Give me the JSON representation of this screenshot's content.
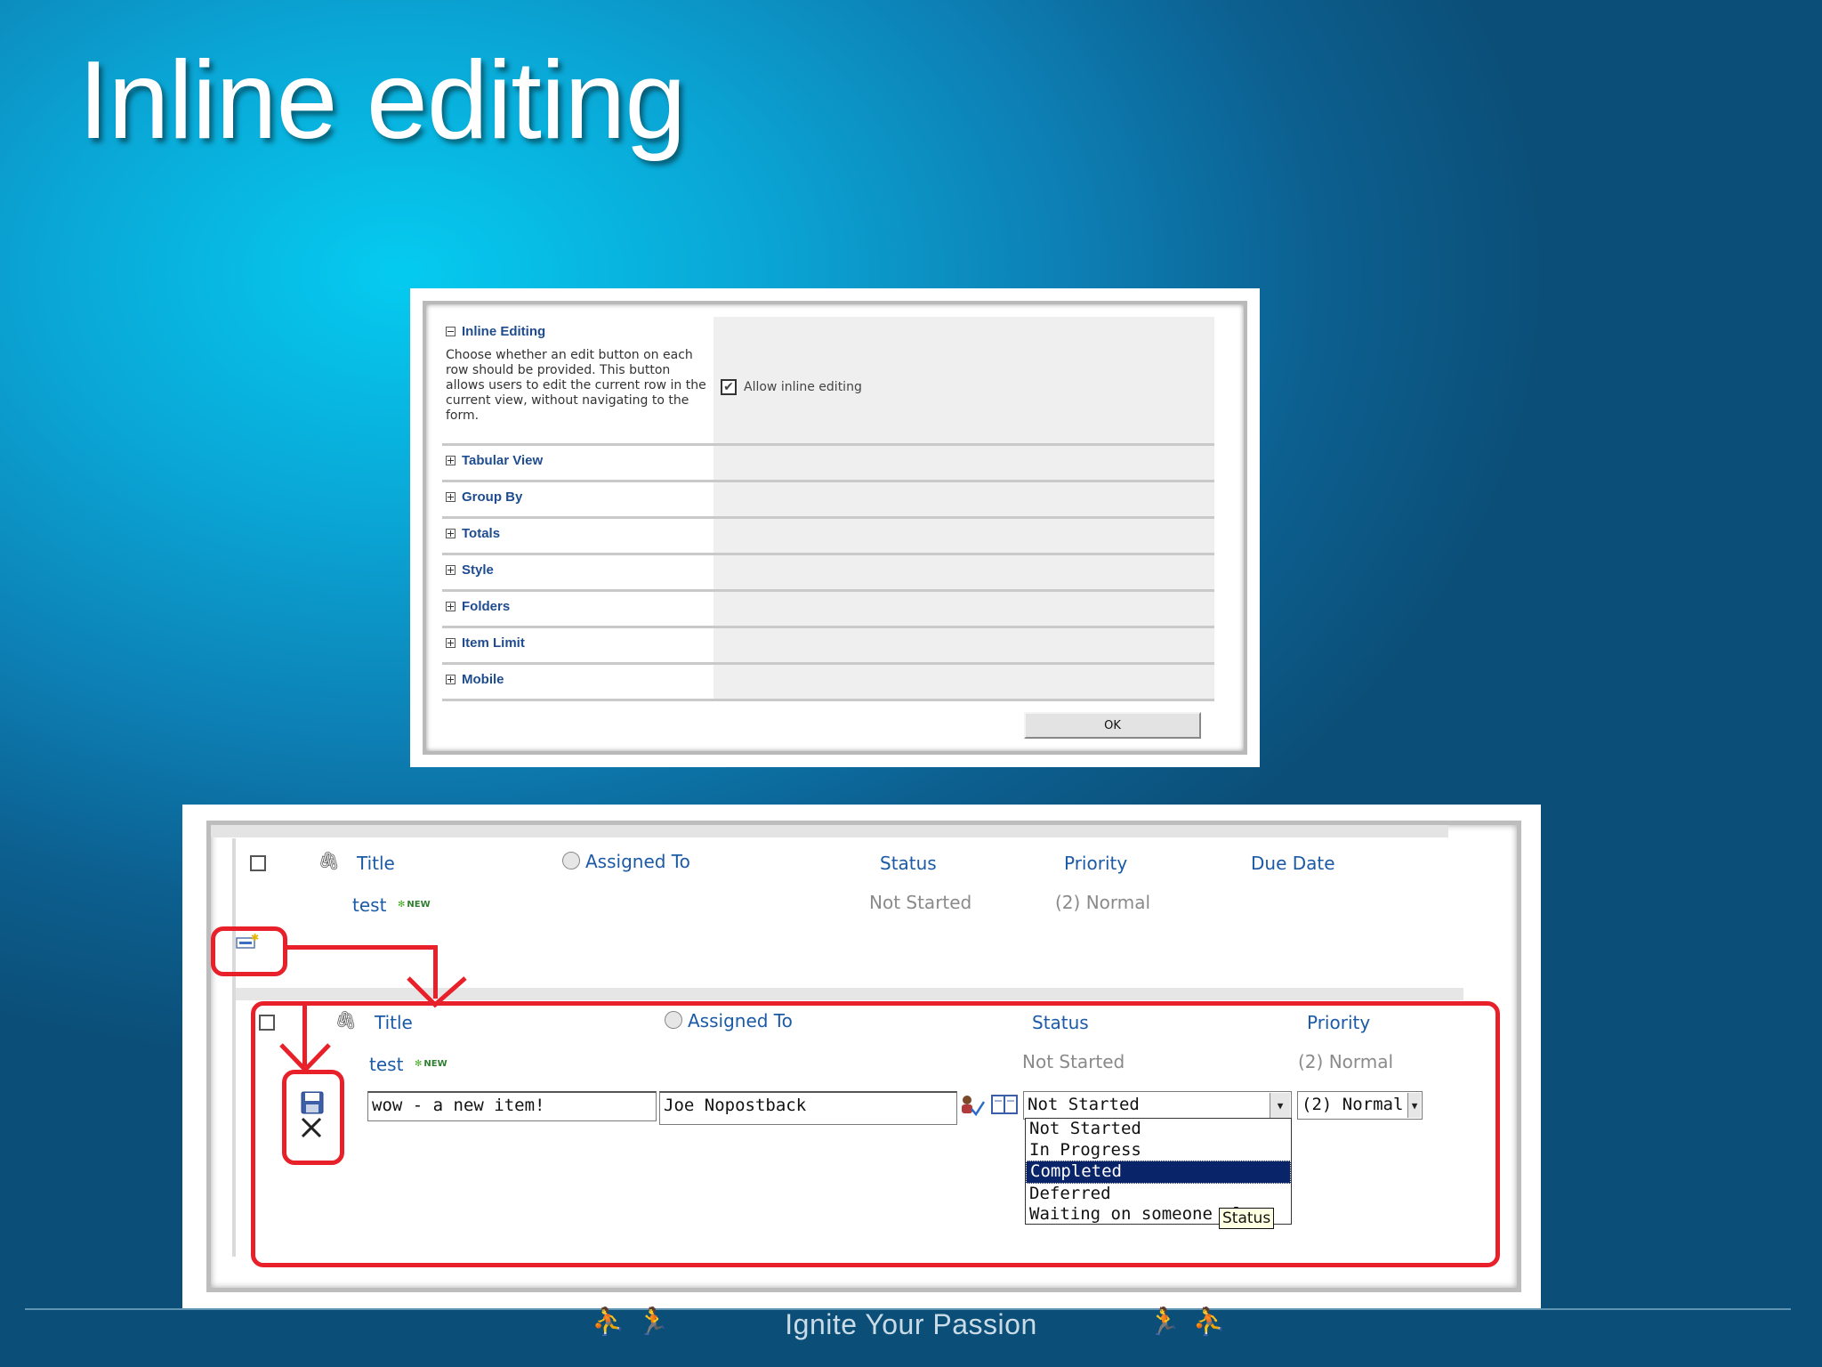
{
  "slide": {
    "title": "Inline editing",
    "footer": "Ignite Your Passion"
  },
  "settings": {
    "inline_editing": {
      "heading": "Inline Editing",
      "description": "Choose whether an edit button on each row should be provided. This button allows users to edit the current row in the current view, without navigating to the form.",
      "checkbox_label": "Allow inline editing",
      "checked": true
    },
    "sections": [
      "Tabular View",
      "Group By",
      "Totals",
      "Style",
      "Folders",
      "Item Limit",
      "Mobile"
    ],
    "ok_label": "OK"
  },
  "list_view": {
    "columns": [
      "Title",
      "Assigned To",
      "Status",
      "Priority",
      "Due Date"
    ],
    "row": {
      "title": "test",
      "badge": "NEW",
      "status": "Not Started",
      "priority": "(2) Normal"
    }
  },
  "edit_view": {
    "columns": [
      "Title",
      "Assigned To",
      "Status",
      "Priority"
    ],
    "row": {
      "title": "test",
      "badge": "NEW",
      "status": "Not Started",
      "priority": "(2) Normal"
    },
    "inputs": {
      "title_value": "wow - a new item!",
      "assigned_value": "Joe Nopostback",
      "status_value": "Not Started",
      "priority_value": "(2) Normal"
    },
    "status_options": [
      "Not Started",
      "In Progress",
      "Completed",
      "Deferred",
      "Waiting on someone else"
    ],
    "selected_option": "Completed",
    "tooltip": "Status"
  },
  "colors": {
    "accent_red": "#e8202a",
    "link_blue": "#1b5aa6",
    "selection": "#0a246a"
  }
}
